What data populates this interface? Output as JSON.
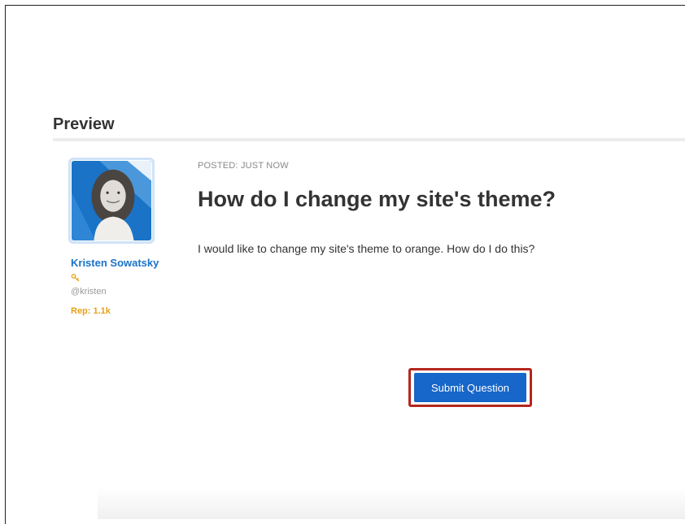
{
  "preview": {
    "heading": "Preview",
    "author": {
      "name": "Kristen Sowatsky",
      "handle": "@kristen",
      "rep": "Rep: 1.1k",
      "badge_icon": "key-icon"
    },
    "post": {
      "posted": "POSTED: JUST NOW",
      "title": "How do I change my site's theme?",
      "body": "I would like to change my site's theme to orange. How do I do this?"
    }
  },
  "actions": {
    "submit_label": "Submit Question"
  },
  "colors": {
    "accent_blue": "#1766c9",
    "author_link": "#1a73c6",
    "rep_orange": "#e6a118",
    "highlight_red": "#b5261e"
  }
}
